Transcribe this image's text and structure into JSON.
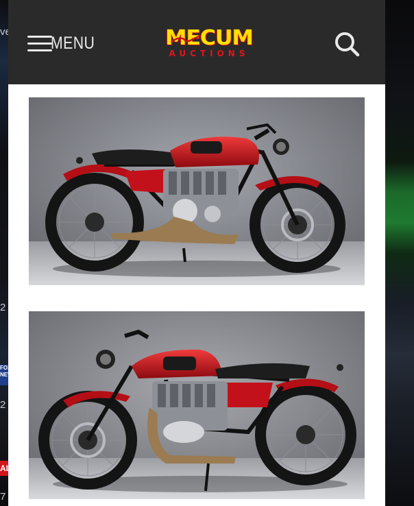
{
  "header": {
    "menu_label": "MENU",
    "logo_top": "MECUM",
    "logo_bottom": "AUCTIONS"
  },
  "background_fragments": [
    "ve",
    "2",
    "2",
    "7"
  ],
  "background_badges": {
    "fox": "FOX NEWS",
    "red": "AL"
  },
  "colors": {
    "header_bg": "#2a2a2a",
    "logo_yellow": "#ffe100",
    "logo_red": "#e3141d",
    "bike_red": "#c8101a"
  },
  "icons": [
    "hamburger-icon",
    "search-icon"
  ],
  "gallery": {
    "photos": [
      {
        "subject": "red cafe racer motorcycle, facing right"
      },
      {
        "subject": "red cafe racer motorcycle, facing left"
      }
    ]
  }
}
